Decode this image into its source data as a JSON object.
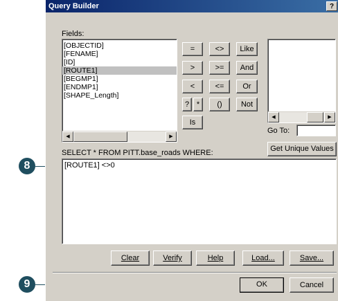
{
  "window": {
    "title": "Query Builder",
    "help_label": "?"
  },
  "fields": {
    "label": "Fields:",
    "items": [
      "[OBJECTID]",
      "[FENAME]",
      "[ID]",
      "[ROUTE1]",
      "[BEGMP1]",
      "[ENDMP1]",
      "[SHAPE_Length]"
    ],
    "selected": "[ROUTE1]"
  },
  "operators": {
    "equals": "=",
    "not_equal": "<>",
    "like": "Like",
    "greater": ">",
    "greater_equal": ">=",
    "and": "And",
    "less": "<",
    "less_equal": "<=",
    "or": "Or",
    "question": "?",
    "star": "*",
    "parens": "()",
    "not": "Not",
    "is": "Is"
  },
  "values": {
    "goto_label": "Go To:",
    "goto_value": "",
    "unique_button": "Get Unique Values"
  },
  "query": {
    "label": "SELECT * FROM PITT.base_roads WHERE:",
    "expression": "[ROUTE1] <>0"
  },
  "actions": {
    "clear": "Clear",
    "verify": "Verify",
    "help": "Help",
    "load": "Load...",
    "save": "Save..."
  },
  "dialog": {
    "ok": "OK",
    "cancel": "Cancel"
  },
  "callouts": {
    "step_8": "8",
    "step_9": "9"
  }
}
